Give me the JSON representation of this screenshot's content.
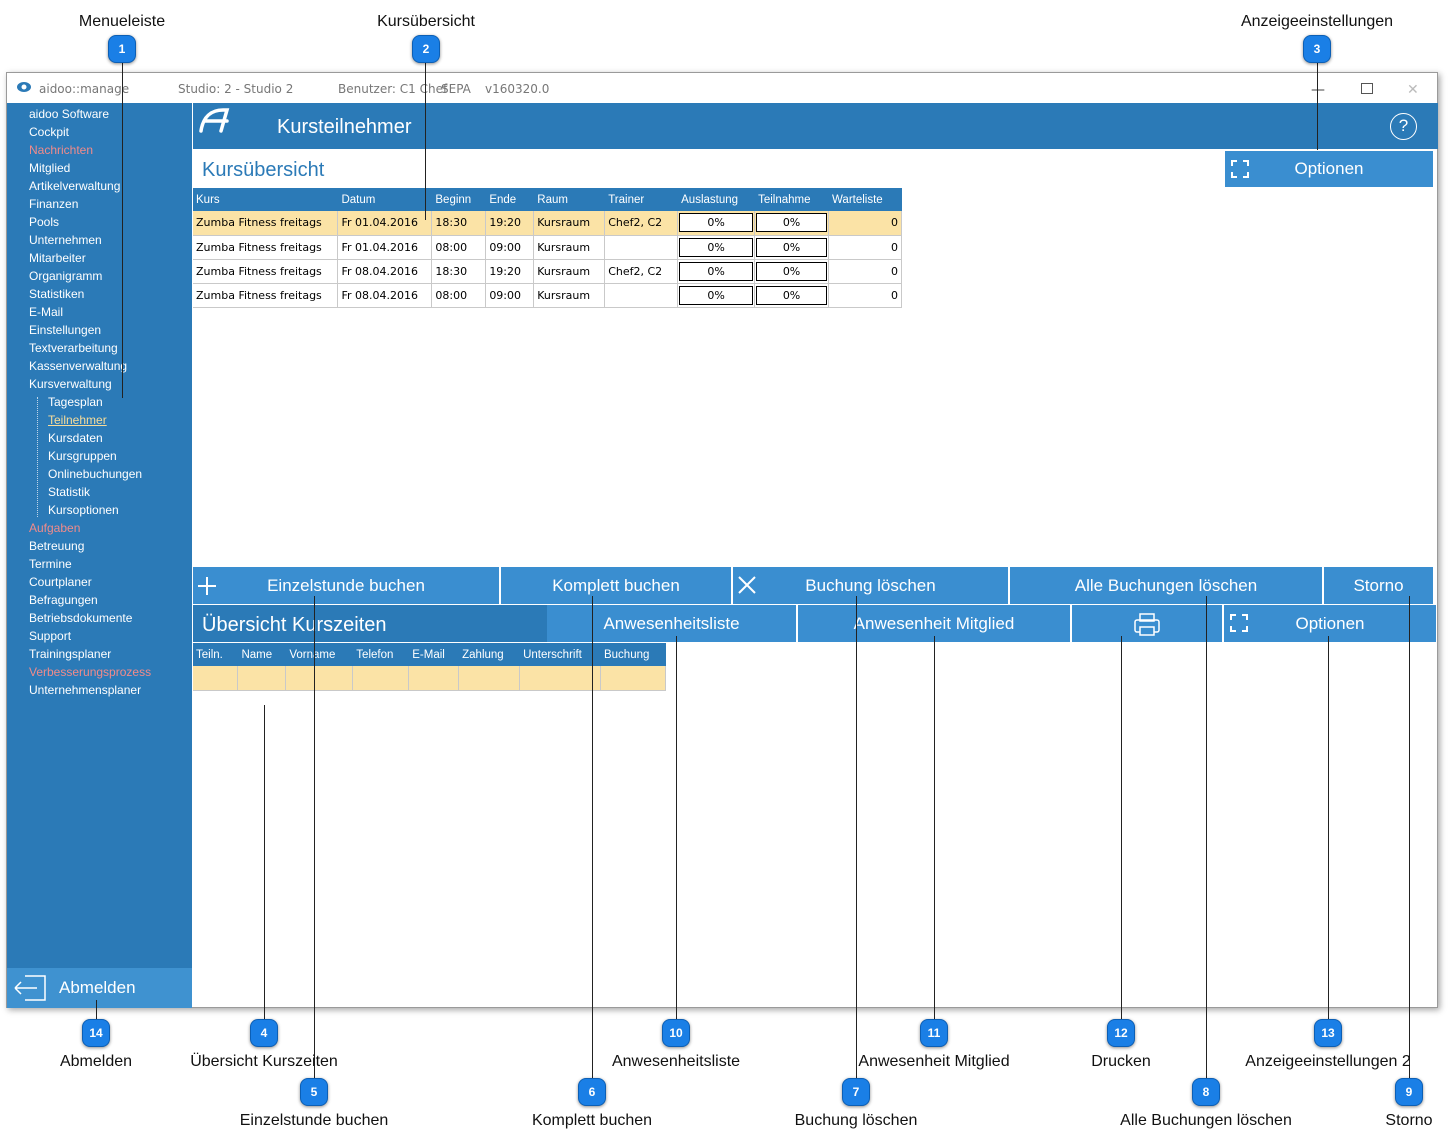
{
  "annotations": {
    "top": [
      {
        "n": "1",
        "label": "Menueleiste"
      },
      {
        "n": "2",
        "label": "Kursübersicht"
      },
      {
        "n": "3",
        "label": "Anzeigeeinstellungen"
      }
    ],
    "bottom": [
      {
        "n": "14",
        "label": "Abmelden"
      },
      {
        "n": "4",
        "label": "Übersicht Kurszeiten"
      },
      {
        "n": "5",
        "label": "Einzelstunde buchen"
      },
      {
        "n": "10",
        "label": "Anwesenheitsliste"
      },
      {
        "n": "6",
        "label": "Komplett buchen"
      },
      {
        "n": "11",
        "label": "Anwesenheit Mitglied"
      },
      {
        "n": "7",
        "label": "Buchung löschen"
      },
      {
        "n": "12",
        "label": "Drucken"
      },
      {
        "n": "8",
        "label": "Alle Buchungen löschen"
      },
      {
        "n": "13",
        "label": "Anzeigeeinstellungen 2"
      },
      {
        "n": "9",
        "label": "Storno"
      }
    ]
  },
  "titlebar": {
    "app": "aidoo::manage",
    "studio": "Studio: 2 - Studio 2",
    "user": "Benutzer: C1 Chef",
    "sepa": "SEPA",
    "version": "v160320.0"
  },
  "menu": [
    {
      "label": "aidoo Software",
      "style": "normal"
    },
    {
      "label": "Cockpit",
      "style": "normal"
    },
    {
      "label": "Nachrichten",
      "style": "red"
    },
    {
      "label": "Mitglied",
      "style": "normal"
    },
    {
      "label": "Artikelverwaltung",
      "style": "normal"
    },
    {
      "label": "Finanzen",
      "style": "normal"
    },
    {
      "label": "Pools",
      "style": "normal"
    },
    {
      "label": "Unternehmen",
      "style": "normal"
    },
    {
      "label": "Mitarbeiter",
      "style": "normal"
    },
    {
      "label": "Organigramm",
      "style": "normal"
    },
    {
      "label": "Statistiken",
      "style": "normal"
    },
    {
      "label": "E-Mail",
      "style": "normal"
    },
    {
      "label": "Einstellungen",
      "style": "normal"
    },
    {
      "label": "Textverarbeitung",
      "style": "normal"
    },
    {
      "label": "Kassenverwaltung",
      "style": "normal"
    },
    {
      "label": "Kursverwaltung",
      "style": "normal"
    },
    {
      "label": "Tagesplan",
      "style": "sub"
    },
    {
      "label": "Teilnehmer",
      "style": "sub-active"
    },
    {
      "label": "Kursdaten",
      "style": "sub"
    },
    {
      "label": "Kursgruppen",
      "style": "sub"
    },
    {
      "label": "Onlinebuchungen",
      "style": "sub"
    },
    {
      "label": "Statistik",
      "style": "sub"
    },
    {
      "label": "Kursoptionen",
      "style": "sub"
    },
    {
      "label": "Aufgaben",
      "style": "red"
    },
    {
      "label": "Betreuung",
      "style": "normal"
    },
    {
      "label": "Termine",
      "style": "normal"
    },
    {
      "label": "Courtplaner",
      "style": "normal"
    },
    {
      "label": "Befragungen",
      "style": "normal"
    },
    {
      "label": "Betriebsdokumente",
      "style": "normal"
    },
    {
      "label": "Support",
      "style": "normal"
    },
    {
      "label": "Trainingsplaner",
      "style": "normal"
    },
    {
      "label": "Verbesserungsprozess",
      "style": "red"
    },
    {
      "label": "Unternehmensplaner",
      "style": "normal"
    }
  ],
  "logout_label": "Abmelden",
  "header": {
    "title": "Kursteilnehmer",
    "help": "?"
  },
  "course_panel": {
    "title": "Kursübersicht",
    "options_label": "Optionen",
    "columns": [
      "Kurs",
      "Datum",
      "Beginn",
      "Ende",
      "Raum",
      "Trainer",
      "Auslastung",
      "Teilnahme",
      "Warteliste"
    ],
    "rows": [
      [
        "Zumba Fitness freitags",
        "Fr 01.04.2016",
        "18:30",
        "19:20",
        "Kursraum",
        "Chef2, C2",
        "0%",
        "0%",
        "0"
      ],
      [
        "Zumba Fitness freitags",
        "Fr 01.04.2016",
        "08:00",
        "09:00",
        "Kursraum",
        "",
        "0%",
        "0%",
        "0"
      ],
      [
        "Zumba Fitness freitags",
        "Fr 08.04.2016",
        "18:30",
        "19:20",
        "Kursraum",
        "Chef2, C2",
        "0%",
        "0%",
        "0"
      ],
      [
        "Zumba Fitness freitags",
        "Fr 08.04.2016",
        "08:00",
        "09:00",
        "Kursraum",
        "",
        "0%",
        "0%",
        "0"
      ]
    ]
  },
  "actions": {
    "single": "Einzelstunde buchen",
    "complete": "Komplett buchen",
    "delete": "Buchung löschen",
    "delete_all": "Alle Buchungen löschen",
    "cancel": "Storno"
  },
  "times_panel": {
    "title": "Übersicht Kurszeiten",
    "attendance_list": "Anwesenheitsliste",
    "attendance_member": "Anwesenheit Mitglied",
    "options_label": "Optionen",
    "columns": [
      "Teiln.",
      "Name",
      "Vorname",
      "Telefon",
      "E-Mail",
      "Zahlung",
      "Unterschrift",
      "Buchung"
    ]
  }
}
